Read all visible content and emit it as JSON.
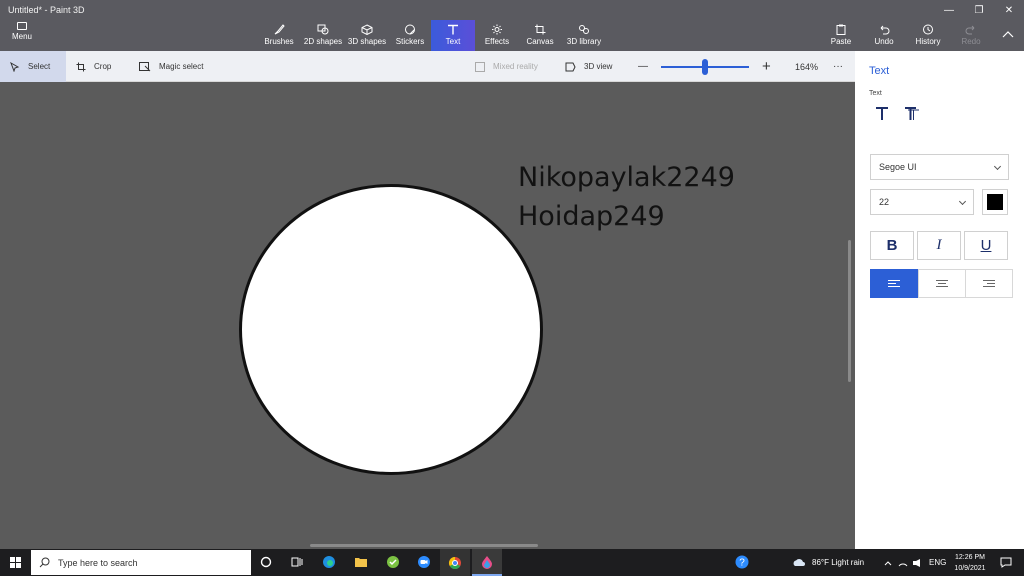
{
  "window": {
    "title": "Untitled* - Paint 3D",
    "minimize_glyph": "—",
    "restore_glyph": "❐",
    "close_glyph": "✕"
  },
  "ribbon": {
    "menu_label": "Menu",
    "tools": [
      {
        "label": "Brushes",
        "icon": "brush-icon"
      },
      {
        "label": "2D shapes",
        "icon": "2d-shapes-icon"
      },
      {
        "label": "3D shapes",
        "icon": "3d-shapes-icon"
      },
      {
        "label": "Stickers",
        "icon": "stickers-icon"
      },
      {
        "label": "Text",
        "icon": "text-icon",
        "active": true
      },
      {
        "label": "Effects",
        "icon": "effects-icon"
      },
      {
        "label": "Canvas",
        "icon": "canvas-icon"
      },
      {
        "label": "3D library",
        "icon": "3d-library-icon"
      }
    ],
    "paste_label": "Paste",
    "undo_label": "Undo",
    "history_label": "History",
    "redo_label": "Redo"
  },
  "toolbar": {
    "select_label": "Select",
    "crop_label": "Crop",
    "magic_select_label": "Magic select",
    "mixed_reality_label": "Mixed reality",
    "view3d_label": "3D view",
    "zoom_minus": "—",
    "zoom_plus": "+",
    "zoom_level": "164%",
    "zoom_fraction": 0.5,
    "more_label": "···"
  },
  "pane": {
    "title": "Text",
    "section_label": "Text",
    "font_family": "Segoe UI",
    "font_size": "22",
    "text_color": "#000000",
    "bold_label": "B",
    "italic_label": "I",
    "underline_label": "U",
    "alignment": "left"
  },
  "canvas": {
    "text_line_1": "Nikopaylak2249",
    "text_line_2": "Hoidap249",
    "shape": "circle"
  },
  "taskbar": {
    "search_placeholder": "Type here to search",
    "weather": "86°F  Light rain",
    "language": "ENG",
    "time": "12:26 PM",
    "date": "10/9/2021"
  },
  "colors": {
    "accent": "#2c5fd6",
    "ribbon": "#5a5a60",
    "canvas_bg": "#5b5b5b",
    "taskbar": "#1d1d1f"
  }
}
